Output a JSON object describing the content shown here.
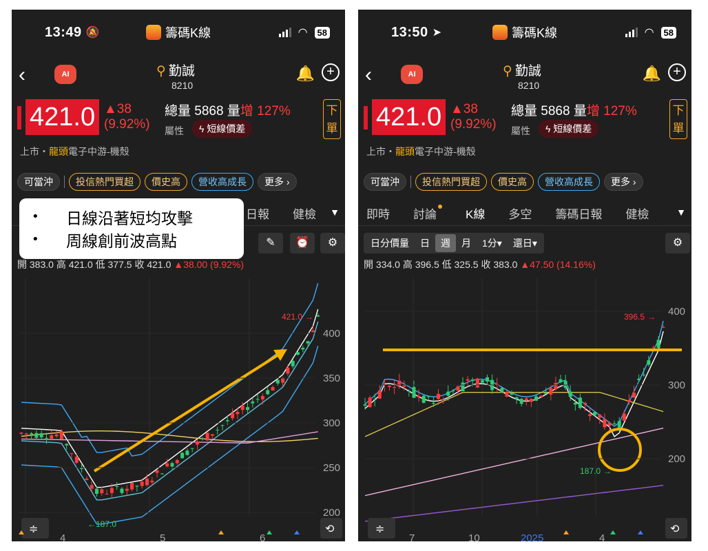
{
  "phones": [
    {
      "time": "13:49",
      "time_icon": "bell-slash-icon",
      "app_name": "籌碼K線",
      "battery": "58",
      "stock": {
        "name": "勤誠",
        "code": "8210"
      },
      "quote": {
        "price": "421.0",
        "change": "▲38",
        "change_pct": "(9.92%)",
        "volume_label": "總量",
        "volume": "5868",
        "volume_change_label": "量",
        "volume_change_word": "增",
        "volume_change": "127%",
        "attr_label": "屬性",
        "attr_tag": "短線價差",
        "order_label": "下單"
      },
      "market": {
        "prefix": "上市・",
        "highlight": "龍頭",
        "rest": "電子中游-機殼"
      },
      "tags": [
        "可當沖",
        "投信熱門買超",
        "價史高",
        "營收高成長",
        "更多 ›"
      ],
      "tabs_visible": [
        "日報",
        "健檢"
      ],
      "ohlc": {
        "text": "開 383.0  高 421.0  低 377.5  收 421.0 ",
        "change": "▲38.00 (9.92%)"
      },
      "chart": {
        "y_ticks": [
          "400",
          "350",
          "300",
          "250",
          "200"
        ],
        "x_ticks": [
          "4",
          "5",
          "6"
        ],
        "high_label": "421.0",
        "low_label": "187.0"
      }
    },
    {
      "time": "13:50",
      "time_icon": "location-arrow-icon",
      "app_name": "籌碼K線",
      "battery": "58",
      "stock": {
        "name": "勤誠",
        "code": "8210"
      },
      "quote": {
        "price": "421.0",
        "change": "▲38",
        "change_pct": "(9.92%)",
        "volume_label": "總量",
        "volume": "5868",
        "volume_change_label": "量",
        "volume_change_word": "增",
        "volume_change": "127%",
        "attr_label": "屬性",
        "attr_tag": "短線價差",
        "order_label": "下單"
      },
      "market": {
        "prefix": "上市・",
        "highlight": "龍頭",
        "rest": "電子中游-機殼"
      },
      "tags": [
        "可當沖",
        "投信熱門買超",
        "價史高",
        "營收高成長",
        "更多 ›"
      ],
      "tabs": [
        "即時",
        "討論",
        "K線",
        "多空",
        "籌碼日報",
        "健檢"
      ],
      "periods": [
        "日分價量",
        "日",
        "週",
        "月",
        "1分▾",
        "還日▾"
      ],
      "ohlc": {
        "text": "開 334.0  高 396.5  低 325.5  收 383.0 ",
        "change": "▲47.50 (14.16%)"
      },
      "chart": {
        "y_ticks": [
          "400",
          "300",
          "200"
        ],
        "x_ticks": [
          "7",
          "10",
          "2025",
          "4"
        ],
        "high_label": "396.5",
        "low_label": "187.0"
      }
    }
  ],
  "annotation": {
    "lines": [
      "日線沿著短均攻擊",
      "周線創前波高點"
    ]
  },
  "colors": {
    "up": "#ff3b3b",
    "down": "#2ecc71",
    "accent": "#f5a623",
    "annotation": "#f5b300"
  }
}
